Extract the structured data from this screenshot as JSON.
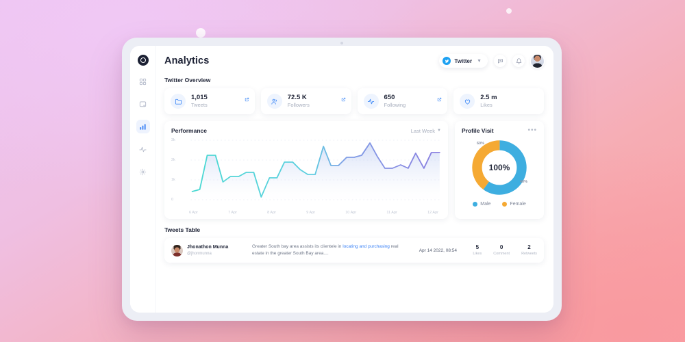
{
  "background": {
    "gradient_from": "#edc6f2",
    "gradient_to": "#fb9ea3"
  },
  "sidebar": {
    "logo_name": "app-logo",
    "items": [
      {
        "icon": "grid-icon",
        "active": false
      },
      {
        "icon": "chat-square-icon",
        "active": false
      },
      {
        "icon": "bar-chart-icon",
        "active": true
      },
      {
        "icon": "activity-pulse-icon",
        "active": false
      },
      {
        "icon": "gear-icon",
        "active": false
      }
    ],
    "active_accent": "#3b82f6"
  },
  "header": {
    "title": "Analytics",
    "source_selector": {
      "label": "Twitter",
      "icon": "twitter-icon",
      "chevron": "chevron-down-icon"
    },
    "message_icon": "message-icon",
    "bell_icon": "bell-icon",
    "avatar": "user-avatar"
  },
  "overview": {
    "label": "Twitter Overview",
    "cards": [
      {
        "value": "1,015",
        "label": "Tweets",
        "icon": "folder-icon",
        "has_link": true
      },
      {
        "value": "72.5 K",
        "label": "Followers",
        "icon": "people-icon",
        "has_link": true
      },
      {
        "value": "650",
        "label": "Following",
        "icon": "activity-icon",
        "has_link": true
      },
      {
        "value": "2.5 m",
        "label": "Likes",
        "icon": "heart-icon",
        "has_link": false
      }
    ]
  },
  "performance": {
    "title": "Performance",
    "range_label": "Last Week",
    "chart_data": {
      "type": "line",
      "title": "Performance",
      "xlabel": "",
      "ylabel": "",
      "ylim": [
        0,
        3500
      ],
      "ytick_labels": [
        "3k",
        "2k",
        "1k",
        "0"
      ],
      "ytick_values": [
        3000,
        2000,
        1000,
        0
      ],
      "grid": true,
      "x_tick_labels": [
        "6 Apr",
        "7 Apr",
        "8 Apr",
        "9 Apr",
        "10 Apr",
        "11 Apr",
        "12 Apr"
      ],
      "legend": "none",
      "series": [
        {
          "name": "Performance",
          "color_start": "#4bd9d2",
          "color_end": "#8b7fe0",
          "values": [
            420,
            520,
            1720,
            1720,
            870,
            1150,
            1150,
            1330,
            1330,
            150,
            1070,
            1070,
            1840,
            1840,
            1500,
            1250,
            1250,
            2880,
            1930,
            1930,
            2320,
            2320,
            2420,
            3010,
            2380,
            1690,
            1690,
            1870,
            1690,
            2480,
            1690,
            2500
          ]
        }
      ]
    }
  },
  "profile_visit": {
    "title": "Profile Visit",
    "menu_icon": "more-dots-icon",
    "center_label": "100%",
    "chart_data": {
      "type": "pie",
      "title": "Profile Visit",
      "labels": [
        "Male",
        "Female"
      ],
      "values": [
        60,
        40
      ],
      "value_labels": [
        "60%",
        "40%"
      ],
      "colors": [
        "#3eaee0",
        "#f5a933"
      ],
      "legend": "bottom",
      "donut": true
    }
  },
  "tweets": {
    "title": "Tweets Table",
    "rows": [
      {
        "avatar": "tweet-author-avatar",
        "name": "Jhonathon Munna",
        "handle": "@jhonmunna",
        "text_before": "Greater South bay area assists its clientele in ",
        "text_link": "locating and purchasing",
        "text_after": " real estate in the greater South Bay area....",
        "date": "Apr 14 2022, 08:54",
        "stats": [
          {
            "count": "5",
            "label": "Likes"
          },
          {
            "count": "0",
            "label": "Comment"
          },
          {
            "count": "2",
            "label": "Retweets"
          }
        ]
      }
    ]
  }
}
